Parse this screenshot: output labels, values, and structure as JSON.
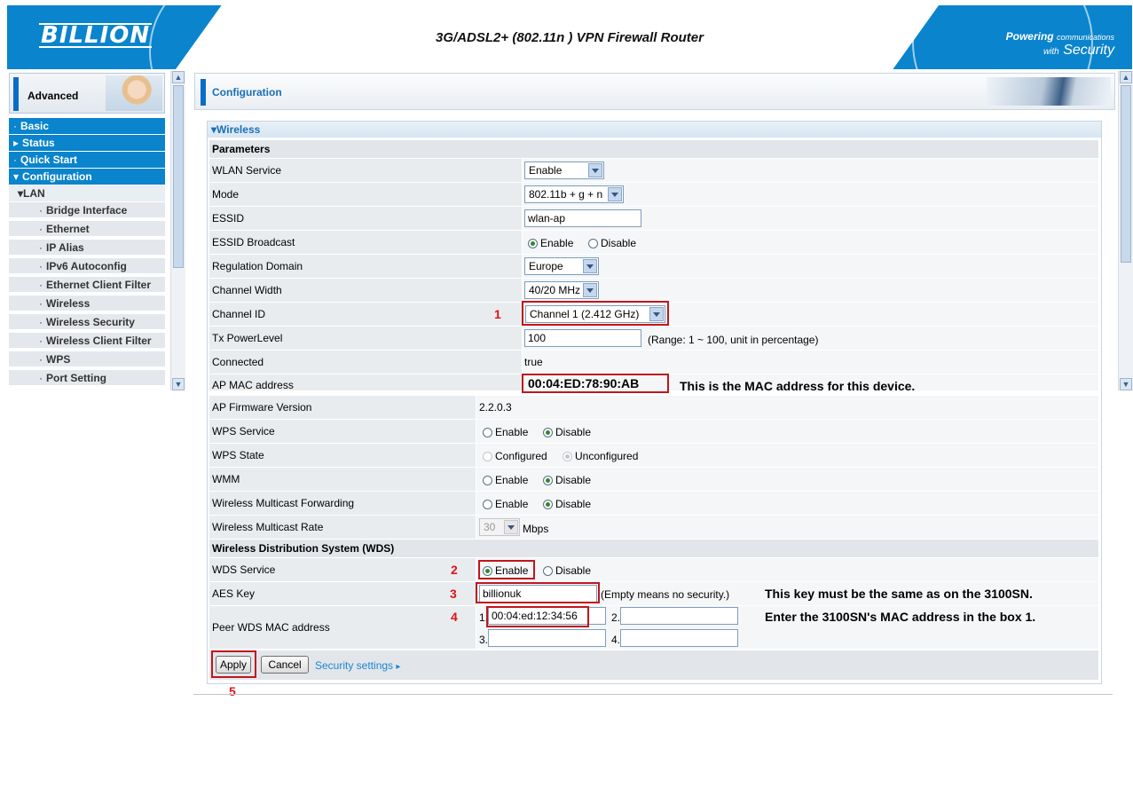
{
  "header": {
    "logo": "BILLION",
    "title": "3G/ADSL2+ (802.11n ) VPN Firewall Router",
    "tagline_powering": "Powering",
    "tagline_communications": "communications",
    "tagline_with": "with",
    "tagline_security": "Security"
  },
  "sidebar": {
    "mode": "Advanced",
    "top_items": [
      "Basic",
      "Status",
      "Quick Start",
      "Configuration"
    ],
    "sub_group": "LAN",
    "lan_items": [
      "Bridge Interface",
      "Ethernet",
      "IP Alias",
      "IPv6 Autoconfig",
      "Ethernet Client Filter",
      "Wireless",
      "Wireless Security",
      "Wireless Client Filter",
      "WPS",
      "Port Setting"
    ]
  },
  "page": {
    "title": "Configuration",
    "panel_title": "Wireless"
  },
  "params": {
    "section": "Parameters",
    "wlan_service_label": "WLAN Service",
    "wlan_service_value": "Enable",
    "mode_label": "Mode",
    "mode_value": "802.11b + g + n",
    "essid_label": "ESSID",
    "essid_value": "wlan-ap",
    "essid_broadcast_label": "ESSID Broadcast",
    "enable": "Enable",
    "disable": "Disable",
    "regulation_label": "Regulation Domain",
    "regulation_value": "Europe",
    "channel_width_label": "Channel Width",
    "channel_width_value": "40/20 MHz",
    "channel_id_label": "Channel ID",
    "channel_id_value": "Channel 1 (2.412 GHz)",
    "tx_label": "Tx PowerLevel",
    "tx_value": "100",
    "tx_hint": "(Range: 1 ~ 100, unit in percentage)",
    "connected_label": "Connected",
    "connected_value": "true",
    "ap_mac_label": "AP MAC address",
    "ap_mac_value": "00:04:ED:78:90:AB",
    "fw_label": "AP Firmware Version",
    "fw_value": "2.2.0.3",
    "wps_service_label": "WPS Service",
    "wps_state_label": "WPS State",
    "configured": "Configured",
    "unconfigured": "Unconfigured",
    "wmm_label": "WMM",
    "mcast_fwd_label": "Wireless Multicast Forwarding",
    "mcast_rate_label": "Wireless Multicast Rate",
    "mcast_rate_value": "30",
    "mcast_rate_unit": "Mbps"
  },
  "wds": {
    "section": "Wireless Distribution System (WDS)",
    "service_label": "WDS Service",
    "aes_label": "AES Key",
    "aes_value": "billionuk",
    "aes_hint": "(Empty means no security.)",
    "peer_label": "Peer WDS MAC address",
    "peer1_idx": "1.",
    "peer1_value": "00:04:ed:12:34:56",
    "peer2_idx": "2.",
    "peer3_idx": "3.",
    "peer4_idx": "4."
  },
  "buttons": {
    "apply": "Apply",
    "cancel": "Cancel",
    "security_link": "Security settings"
  },
  "annotations": {
    "n1": "1",
    "n2": "2",
    "n3": "3",
    "n4": "4",
    "n5": "5",
    "mac_note": "This is the MAC address for this device.",
    "key_note": "This key must be the same as on the 3100SN.",
    "peer_note": "Enter the 3100SN's MAC address in the box 1."
  },
  "colors": {
    "brand_blue": "#0a84cc",
    "annotation_red": "#c0161c"
  }
}
